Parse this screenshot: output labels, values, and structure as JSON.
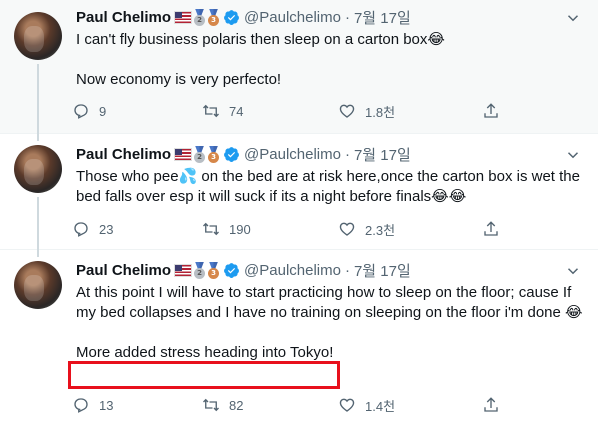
{
  "tweets": [
    {
      "name": "Paul Chelimo",
      "handle": "@Paulchelimo",
      "separator": "·",
      "date": "7월 17일",
      "lines": [
        "I can't fly business polaris then sleep on a carton box😂",
        "Now economy is very perfecto!"
      ],
      "replies": "9",
      "retweets": "74",
      "likes": "1.8천"
    },
    {
      "name": "Paul Chelimo",
      "handle": "@Paulchelimo",
      "separator": "·",
      "date": "7월 17일",
      "lines": [
        "Those who pee💦 on the bed are at risk here,once the carton box is wet the bed falls over esp it will suck if its a night before finals😂😂"
      ],
      "replies": "23",
      "retweets": "190",
      "likes": "2.3천"
    },
    {
      "name": "Paul Chelimo",
      "handle": "@Paulchelimo",
      "separator": "·",
      "date": "7월 17일",
      "lines": [
        "At this point I will have to start practicing how to sleep on the floor; cause If my bed collapses  and I have no training on sleeping on the floor i'm done 😂",
        "More added stress heading into Tokyo!"
      ],
      "replies": "13",
      "retweets": "82",
      "likes": "1.4천"
    }
  ],
  "medals": {
    "silver_num": "2",
    "bronze_num": "3"
  },
  "colors": {
    "highlight": "#e8101c",
    "verified": "#1d9bf0",
    "muted": "#536471"
  },
  "icons": [
    "reply-icon",
    "retweet-icon",
    "like-icon",
    "share-icon",
    "more-chevron-icon",
    "verified-icon",
    "us-flag-icon",
    "silver-medal-icon",
    "bronze-medal-icon"
  ]
}
